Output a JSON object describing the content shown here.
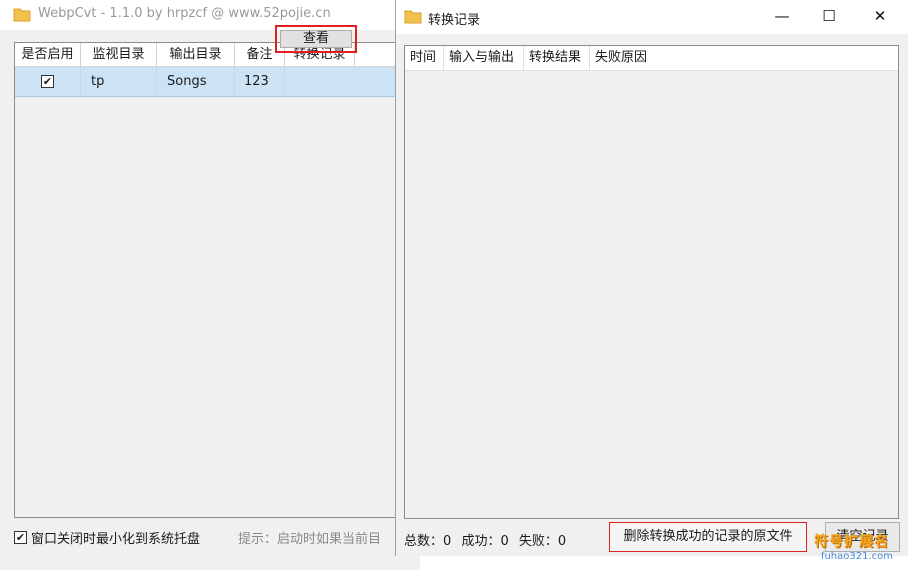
{
  "main_window": {
    "title": "WebpCvt - 1.1.0 by hrpzcf @ www.52pojie.cn",
    "icon": "folder-icon",
    "grid": {
      "columns": [
        "是否启用",
        "监视目录",
        "输出目录",
        "备注",
        "转换记录"
      ],
      "row": {
        "enabled": true,
        "watch_dir": "tp",
        "output_dir": "Songs",
        "note": "123",
        "view_label": "查看"
      }
    },
    "minimize_to_tray": {
      "checked": true,
      "label": "窗口关闭时最小化到系统托盘"
    },
    "hint": "提示：启动时如果当前目"
  },
  "record_window": {
    "title": "转换记录",
    "icon": "folder-icon",
    "controls": {
      "minimize": "—",
      "maximize": "☐",
      "close": "✕"
    },
    "columns": [
      "时间",
      "输入与输出",
      "转换结果",
      "失败原因"
    ],
    "summary": {
      "total_label": "总数：",
      "total": "0",
      "success_label": "成功：",
      "success": "0",
      "fail_label": "失败：",
      "fail": "0"
    },
    "delete_button": "删除转换成功的记录的原文件",
    "clear_button": "清空记录"
  },
  "watermark": {
    "line1": "符号扩展名",
    "line2": "fuhao321.com"
  },
  "colors": {
    "selection": "#cce3f5",
    "highlight": "#e02020",
    "folder": "#f2c14e"
  }
}
